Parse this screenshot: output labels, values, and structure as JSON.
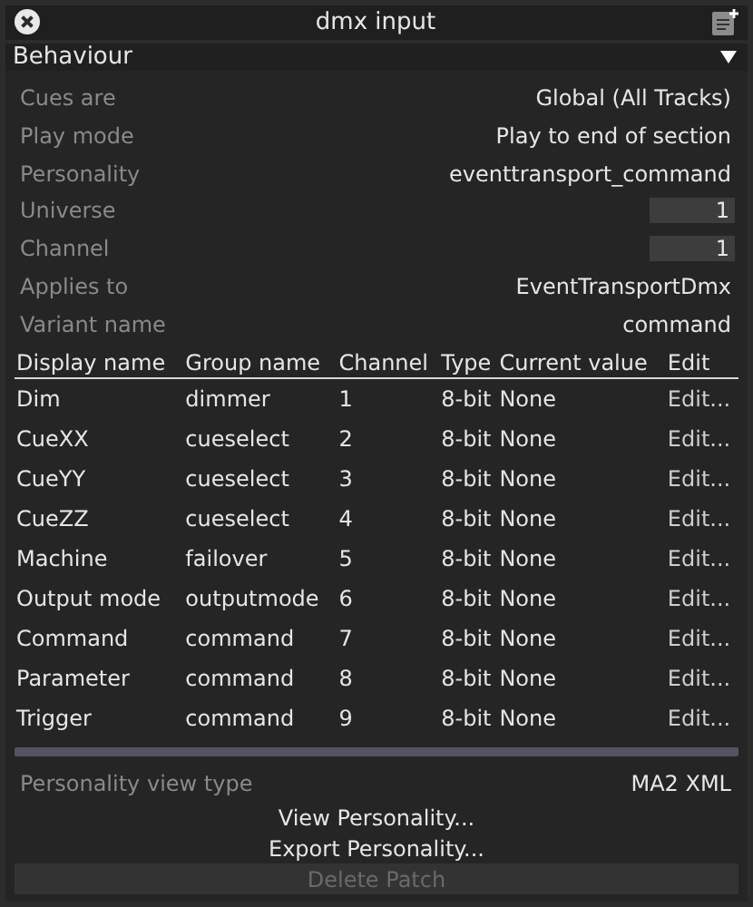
{
  "window": {
    "title": "dmx input"
  },
  "section": {
    "title": "Behaviour",
    "expanded": true
  },
  "properties": [
    {
      "label": "Cues are",
      "value": "Global (All Tracks)",
      "kind": "text"
    },
    {
      "label": "Play mode",
      "value": "Play to end of section",
      "kind": "text"
    },
    {
      "label": "Personality",
      "value": "eventtransport_command",
      "kind": "text"
    },
    {
      "label": "Universe",
      "value": "1",
      "kind": "number"
    },
    {
      "label": "Channel",
      "value": "1",
      "kind": "number"
    },
    {
      "label": "Applies to",
      "value": "EventTransportDmx",
      "kind": "text"
    },
    {
      "label": "Variant name",
      "value": "command",
      "kind": "text"
    }
  ],
  "table": {
    "columns": [
      "Display name",
      "Group name",
      "Channel",
      "Type",
      "Current value",
      "Edit"
    ],
    "rows": [
      [
        "Dim",
        "dimmer",
        "1",
        "8-bit",
        "None",
        "Edit..."
      ],
      [
        "CueXX",
        "cueselect",
        "2",
        "8-bit",
        "None",
        "Edit..."
      ],
      [
        "CueYY",
        "cueselect",
        "3",
        "8-bit",
        "None",
        "Edit..."
      ],
      [
        "CueZZ",
        "cueselect",
        "4",
        "8-bit",
        "None",
        "Edit..."
      ],
      [
        "Machine",
        "failover",
        "5",
        "8-bit",
        "None",
        "Edit..."
      ],
      [
        "Output mode",
        "outputmode",
        "6",
        "8-bit",
        "None",
        "Edit..."
      ],
      [
        "Command",
        "command",
        "7",
        "8-bit",
        "None",
        "Edit..."
      ],
      [
        "Parameter",
        "command",
        "8",
        "8-bit",
        "None",
        "Edit..."
      ],
      [
        "Trigger",
        "command",
        "9",
        "8-bit",
        "None",
        "Edit..."
      ]
    ]
  },
  "view_type": {
    "label": "Personality view type",
    "value": "MA2 XML"
  },
  "buttons": [
    {
      "label": "View Personality...",
      "disabled": false
    },
    {
      "label": "Export Personality...",
      "disabled": false
    },
    {
      "label": "Delete Patch",
      "disabled": true
    }
  ]
}
